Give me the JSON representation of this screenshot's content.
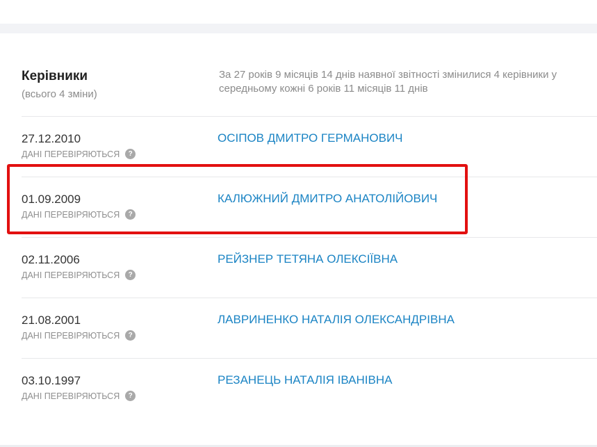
{
  "section": {
    "title": "Керівники",
    "subtitle": "(всього 4 зміни)",
    "summary_line1": "За 27 років 9 місяців 14 днів наявної звітності змінилися 4 керівники у",
    "summary_line2": "середньому кожні 6 років 11 місяців 11 днів"
  },
  "rows": [
    {
      "date": "27.12.2010",
      "status": "ДАНІ ПЕРЕВІРЯЮТЬСЯ",
      "name": "ОСІПОВ ДМИТРО ГЕРМАНОВИЧ"
    },
    {
      "date": "01.09.2009",
      "status": "ДАНІ ПЕРЕВІРЯЮТЬСЯ",
      "name": "КАЛЮЖНИЙ ДМИТРО АНАТОЛІЙОВИЧ"
    },
    {
      "date": "02.11.2006",
      "status": "ДАНІ ПЕРЕВІРЯЮТЬСЯ",
      "name": "РЕЙЗНЕР ТЕТЯНА ОЛЕКСІЇВНА"
    },
    {
      "date": "21.08.2001",
      "status": "ДАНІ ПЕРЕВІРЯЮТЬСЯ",
      "name": "ЛАВРИНЕНКО НАТАЛІЯ ОЛЕКСАНДРІВНА"
    },
    {
      "date": "03.10.1997",
      "status": "ДАНІ ПЕРЕВІРЯЮТЬСЯ",
      "name": "РЕЗАНЕЦЬ НАТАЛІЯ ІВАНІВНА"
    }
  ],
  "help_icon_glyph": "?",
  "colors": {
    "link": "#1b84c4",
    "highlight": "#e21010",
    "muted": "#8b8b8b"
  }
}
